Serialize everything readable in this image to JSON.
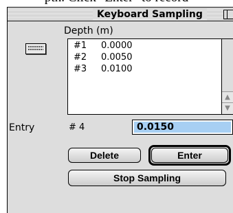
{
  "background_text": "pth. Click \"Enter\" to record",
  "window": {
    "title": "Keyboard Sampling",
    "column_header": "Depth (m)",
    "entries": [
      {
        "index": "#1",
        "value": "0.0000"
      },
      {
        "index": "#2",
        "value": "0.0050"
      },
      {
        "index": "#3",
        "value": "0.0100"
      }
    ],
    "entry_label": "Entry",
    "entry_index": "# 4",
    "entry_value": "0.0150",
    "buttons": {
      "delete": "Delete",
      "enter": "Enter",
      "stop": "Stop Sampling"
    }
  },
  "colors": {
    "field_highlight": "#a7cff3",
    "window_bg": "#dddddd"
  },
  "icons": [
    "keyboard-icon",
    "scroll-up-icon",
    "scroll-down-icon"
  ]
}
